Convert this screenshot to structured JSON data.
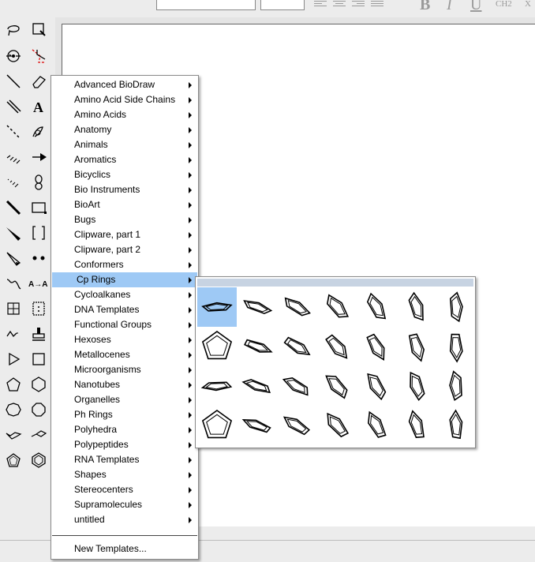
{
  "menu": {
    "items": [
      {
        "label": "Advanced BioDraw"
      },
      {
        "label": "Amino Acid Side Chains"
      },
      {
        "label": "Amino Acids"
      },
      {
        "label": "Anatomy"
      },
      {
        "label": "Animals"
      },
      {
        "label": "Aromatics"
      },
      {
        "label": "Bicyclics"
      },
      {
        "label": "Bio Instruments"
      },
      {
        "label": "BioArt"
      },
      {
        "label": "Bugs"
      },
      {
        "label": "Clipware, part 1"
      },
      {
        "label": "Clipware, part 2"
      },
      {
        "label": "Conformers"
      },
      {
        "label": "Cp Rings"
      },
      {
        "label": "Cycloalkanes"
      },
      {
        "label": "DNA Templates"
      },
      {
        "label": "Functional Groups"
      },
      {
        "label": "Hexoses"
      },
      {
        "label": "Metallocenes"
      },
      {
        "label": "Microorganisms"
      },
      {
        "label": "Nanotubes"
      },
      {
        "label": "Organelles"
      },
      {
        "label": "Ph Rings"
      },
      {
        "label": "Polyhedra"
      },
      {
        "label": "Polypeptides"
      },
      {
        "label": "RNA Templates"
      },
      {
        "label": "Shapes"
      },
      {
        "label": "Stereocenters"
      },
      {
        "label": "Supramolecules"
      },
      {
        "label": "untitled"
      }
    ],
    "new_templates_label": "New Templates...",
    "highlighted_item": "Cp Rings"
  },
  "toolbar": {
    "bold": "B",
    "italic": "I",
    "underline": "U",
    "subscript_formula": "CH2",
    "extra": "X"
  },
  "tools": {
    "text_tool": "A",
    "label_tool": "A→A"
  },
  "submenu": {
    "name": "Cp Rings",
    "rows": 4,
    "columns": 7,
    "selected_index": 0
  },
  "colors": {
    "highlight": "#9ec9f5",
    "submenu_header": "#c7d3e2"
  }
}
